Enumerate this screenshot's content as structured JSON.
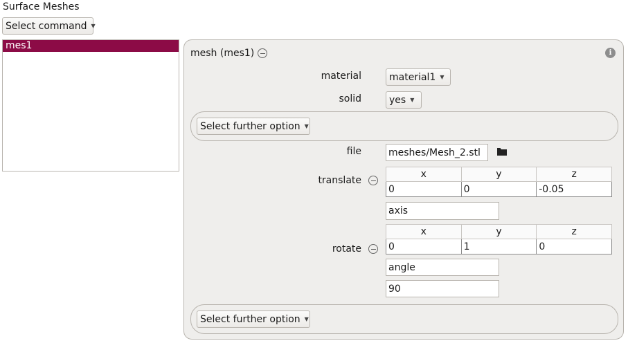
{
  "section_title": "Surface Meshes",
  "command_select": {
    "label": "Select command"
  },
  "mesh_list": {
    "items": [
      "mes1"
    ]
  },
  "panel": {
    "title": "mesh (mes1)",
    "material": {
      "label": "material",
      "value": "material1"
    },
    "solid": {
      "label": "solid",
      "value": "yes"
    },
    "further_option_label": "Select further option",
    "file": {
      "label": "file",
      "value": "meshes/Mesh_2.stl"
    },
    "translate": {
      "label": "translate",
      "headers": [
        "x",
        "y",
        "z"
      ],
      "values": [
        "0",
        "0",
        "-0.05"
      ]
    },
    "rotate": {
      "label": "rotate",
      "axis_label": "axis",
      "headers": [
        "x",
        "y",
        "z"
      ],
      "values": [
        "0",
        "1",
        "0"
      ],
      "angle_label": "angle",
      "angle_value": "90"
    }
  },
  "colors": {
    "selection": "#8c0b46",
    "panel_bg": "#efeeec"
  }
}
